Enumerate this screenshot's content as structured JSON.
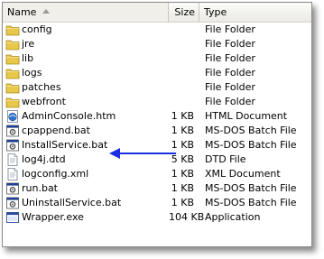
{
  "columns": {
    "name": "Name",
    "size": "Size",
    "type": "Type"
  },
  "files": [
    {
      "name": "config",
      "size": "",
      "type": "File Folder",
      "icon": "folder-icon"
    },
    {
      "name": "jre",
      "size": "",
      "type": "File Folder",
      "icon": "folder-icon"
    },
    {
      "name": "lib",
      "size": "",
      "type": "File Folder",
      "icon": "folder-icon"
    },
    {
      "name": "logs",
      "size": "",
      "type": "File Folder",
      "icon": "folder-icon"
    },
    {
      "name": "patches",
      "size": "",
      "type": "File Folder",
      "icon": "folder-icon"
    },
    {
      "name": "webfront",
      "size": "",
      "type": "File Folder",
      "icon": "folder-icon"
    },
    {
      "name": "AdminConsole.htm",
      "size": "1 KB",
      "type": "HTML Document",
      "icon": "html-document-icon"
    },
    {
      "name": "cpappend.bat",
      "size": "1 KB",
      "type": "MS-DOS Batch File",
      "icon": "batch-file-icon"
    },
    {
      "name": "InstallService.bat",
      "size": "1 KB",
      "type": "MS-DOS Batch File",
      "icon": "batch-file-icon"
    },
    {
      "name": "log4j.dtd",
      "size": "5 KB",
      "type": "DTD File",
      "icon": "document-icon"
    },
    {
      "name": "logconfig.xml",
      "size": "1 KB",
      "type": "XML Document",
      "icon": "document-icon"
    },
    {
      "name": "run.bat",
      "size": "1 KB",
      "type": "MS-DOS Batch File",
      "icon": "batch-file-icon"
    },
    {
      "name": "UninstallService.bat",
      "size": "1 KB",
      "type": "MS-DOS Batch File",
      "icon": "batch-file-icon"
    },
    {
      "name": "Wrapper.exe",
      "size": "104 KB",
      "type": "Application",
      "icon": "application-icon"
    }
  ],
  "highlight": {
    "file": "InstallService.bat",
    "arrow_color": "#1a2fe0"
  }
}
